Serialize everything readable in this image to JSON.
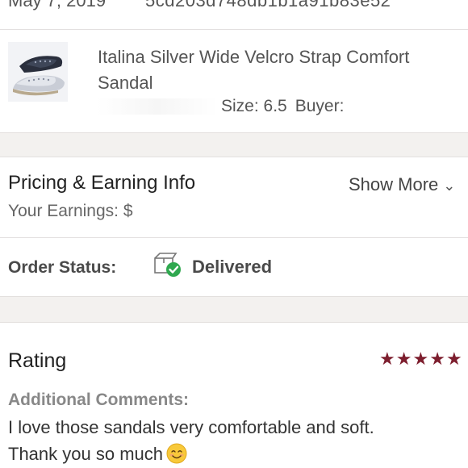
{
  "order": {
    "date": "May 7, 2019",
    "id": "5cd203d748db1b1a91b83e52"
  },
  "item": {
    "title": "Italina Silver Wide Velcro Strap Comfort Sandal",
    "size_label": "Size:",
    "size_value": "6.5",
    "buyer_label": "Buyer:"
  },
  "pricing": {
    "title": "Pricing & Earning Info",
    "earnings_label": "Your Earnings: $",
    "show_more": "Show More"
  },
  "status": {
    "label": "Order Status:",
    "value": "Delivered",
    "color": "#2fa84f"
  },
  "rating": {
    "title": "Rating",
    "stars": 5,
    "star_color": "#7d1e2e",
    "comments_label": "Additional Comments:",
    "comments_line1": "I love those sandals very comfortable and soft.",
    "comments_line2": "Thank you so much"
  }
}
